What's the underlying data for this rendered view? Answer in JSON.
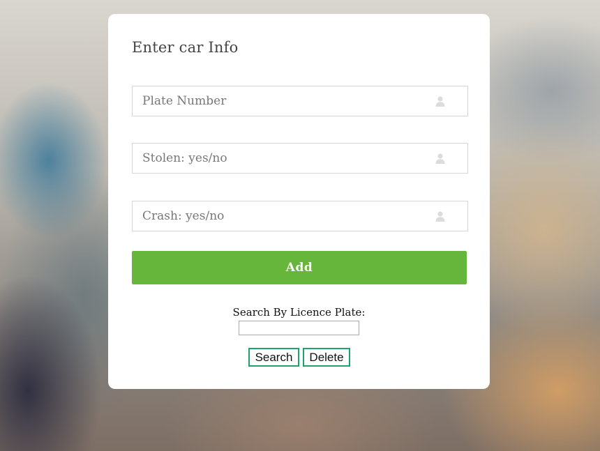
{
  "form": {
    "title": "Enter car Info",
    "fields": [
      {
        "placeholder": "Plate Number",
        "icon": "user-icon"
      },
      {
        "placeholder": "Stolen: yes/no",
        "icon": "user-icon"
      },
      {
        "placeholder": "Crash: yes/no",
        "icon": "user-icon"
      }
    ],
    "add_label": "Add",
    "accent_color": "#66b63c"
  },
  "search": {
    "label": "Search By Licence Plate:",
    "value": "",
    "search_label": "Search",
    "delete_label": "Delete",
    "button_border_color": "#1fa36a"
  }
}
